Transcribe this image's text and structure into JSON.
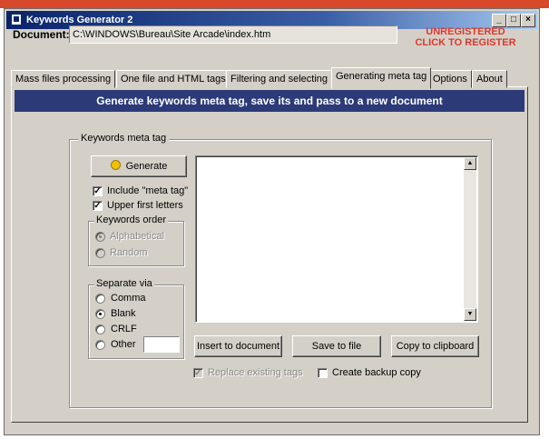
{
  "window": {
    "title": "Keywords Generator 2",
    "buttons": {
      "minimize": "_",
      "maximize": "□",
      "close": "×"
    }
  },
  "document": {
    "label": "Document:",
    "path": "C:\\WINDOWS\\Bureau\\Site Arcade\\index.htm"
  },
  "registration": {
    "line1": "UNREGISTERED",
    "line2": "CLICK TO REGISTER"
  },
  "tabs": [
    {
      "label": "Mass files processing"
    },
    {
      "label": "One file and HTML tags"
    },
    {
      "label": "Filtering and selecting"
    },
    {
      "label": "Generating meta tag"
    },
    {
      "label": "Options"
    },
    {
      "label": "About"
    }
  ],
  "active_tab": "Generating meta tag",
  "banner": "Generate keywords meta tag, save its and pass to a new document",
  "group_title": "Keywords meta tag",
  "generate_button": "Generate",
  "options": {
    "include_meta_tag": {
      "label": "Include \"meta tag\"",
      "checked": true
    },
    "upper_first_letters": {
      "label": "Upper first letters",
      "checked": true
    }
  },
  "keywords_order": {
    "title": "Keywords order",
    "alphabetical": "Alphabetical",
    "random": "Random",
    "selected": "Alphabetical",
    "enabled": false
  },
  "separate_via": {
    "title": "Separate via",
    "comma": "Comma",
    "blank": "Blank",
    "crlf": "CRLF",
    "other": "Other",
    "selected": "Blank",
    "other_value": ""
  },
  "meta_output": "",
  "actions": {
    "insert": "Insert to document",
    "save": "Save to file",
    "copy": "Copy to clipboard"
  },
  "bottom_options": {
    "replace_existing": {
      "label": "Replace existing tags",
      "checked": true,
      "enabled": false
    },
    "backup": {
      "label": "Create backup copy",
      "checked": false
    }
  },
  "icons": {
    "app": "app-icon",
    "generate": "lightbulb-icon",
    "scroll_up": "arrow-up-icon",
    "scroll_down": "arrow-down-icon"
  }
}
